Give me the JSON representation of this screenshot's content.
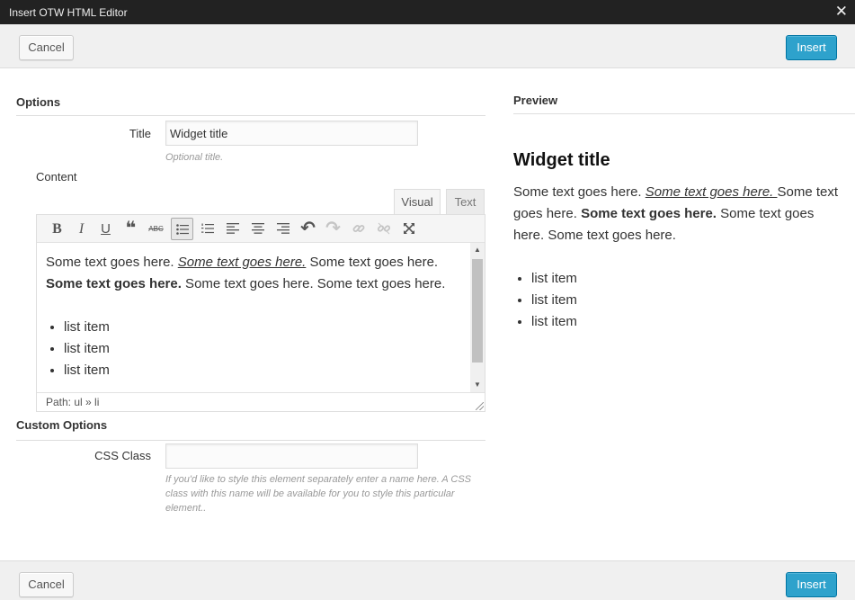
{
  "window": {
    "title": "Insert OTW HTML Editor",
    "close_icon": "close-icon"
  },
  "actions": {
    "cancel_label": "Cancel",
    "insert_label": "Insert"
  },
  "options": {
    "heading": "Options",
    "title_label": "Title",
    "title_value": "Widget title",
    "title_hint": "Optional title.",
    "content_label": "Content"
  },
  "editor": {
    "tabs": [
      "Visual",
      "Text"
    ],
    "active_tab": "Visual",
    "toolbar": [
      {
        "name": "bold-icon",
        "glyph": "B"
      },
      {
        "name": "italic-icon",
        "glyph": "I"
      },
      {
        "name": "underline-icon",
        "glyph": "U"
      },
      {
        "name": "blockquote-icon",
        "glyph": "❝"
      },
      {
        "name": "strikethrough-icon",
        "glyph": "ABC"
      },
      {
        "name": "bullet-list-icon",
        "glyph": "☰"
      },
      {
        "name": "numbered-list-icon",
        "glyph": "1≡"
      },
      {
        "name": "align-left-icon",
        "glyph": "≡"
      },
      {
        "name": "align-center-icon",
        "glyph": "≡"
      },
      {
        "name": "align-right-icon",
        "glyph": "≡"
      },
      {
        "name": "undo-icon",
        "glyph": "↶"
      },
      {
        "name": "redo-icon",
        "glyph": "↷"
      },
      {
        "name": "link-icon",
        "glyph": "🔗"
      },
      {
        "name": "unlink-icon",
        "glyph": "⛓"
      },
      {
        "name": "fullscreen-icon",
        "glyph": "⤢"
      }
    ],
    "content": {
      "seg1": "Some text goes here. ",
      "seg2": "Some text goes here.",
      "seg3": " Some text goes here. ",
      "seg4": "Some text goes here.",
      "seg5": " Some text goes here. Some text goes here.",
      "items": [
        "list item",
        "list item",
        "list item"
      ]
    },
    "path": "Path: ul » li"
  },
  "custom_options": {
    "heading": "Custom Options",
    "css_class_label": "CSS Class",
    "css_class_value": "",
    "css_class_hint": "If you'd like to style this element separately enter a name here. A CSS class with this name will be available for you to style this particular element.."
  },
  "preview": {
    "heading": "Preview",
    "title": "Widget title",
    "seg1": "Some text goes here. ",
    "seg2": "Some text goes here. ",
    "seg3": "Some text goes here. ",
    "seg4": "Some text goes here.",
    "seg5": " Some text goes here. Some text goes here.",
    "items": [
      "list item",
      "list item",
      "list item"
    ]
  }
}
